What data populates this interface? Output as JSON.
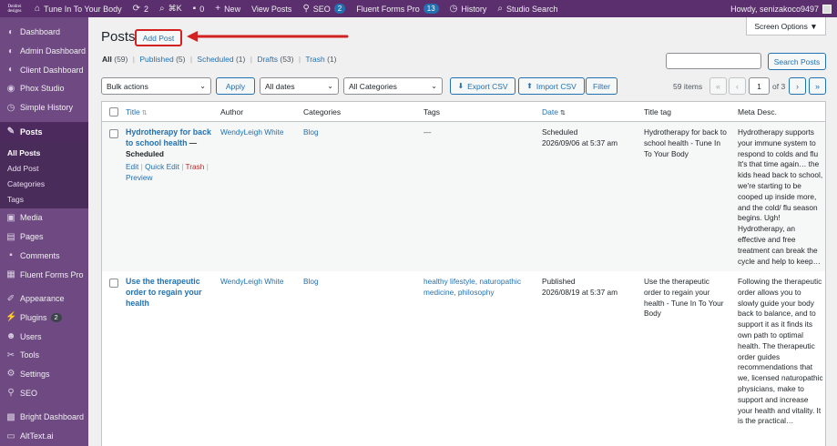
{
  "adminbar": {
    "logo_line1": "Deidrei",
    "logo_line2": "designs",
    "site_name": "Tune In To Your Body",
    "updates_count": "2",
    "shortcut": "⌘K",
    "comments_count": "0",
    "new_label": "New",
    "view_posts": "View Posts",
    "seo_label": "SEO",
    "seo_count": "2",
    "fluent_label": "Fluent Forms Pro",
    "fluent_count": "13",
    "history_label": "History",
    "studio_search": "Studio Search",
    "howdy": "Howdy, senizakoco9497"
  },
  "sidebar": {
    "items": [
      {
        "label": "Dashboard",
        "icon": "dashboard-icon"
      },
      {
        "label": "Admin Dashboard",
        "icon": "admin-dashboard-icon"
      },
      {
        "label": "Client Dashboard",
        "icon": "client-dashboard-icon"
      },
      {
        "label": "Phox Studio",
        "icon": "phox-icon"
      },
      {
        "label": "Simple History",
        "icon": "history-icon"
      },
      {
        "label": "Posts",
        "icon": "posts-icon"
      },
      {
        "label": "Media",
        "icon": "media-icon"
      },
      {
        "label": "Pages",
        "icon": "pages-icon"
      },
      {
        "label": "Comments",
        "icon": "comments-icon"
      },
      {
        "label": "Fluent Forms Pro",
        "icon": "forms-icon"
      },
      {
        "label": "Appearance",
        "icon": "appearance-icon"
      },
      {
        "label": "Plugins",
        "icon": "plugins-icon",
        "badge": "2"
      },
      {
        "label": "Users",
        "icon": "users-icon"
      },
      {
        "label": "Tools",
        "icon": "tools-icon"
      },
      {
        "label": "Settings",
        "icon": "settings-icon"
      },
      {
        "label": "SEO",
        "icon": "seo-icon"
      },
      {
        "label": "Bright Dashboard",
        "icon": "bright-icon"
      },
      {
        "label": "AltText.ai",
        "icon": "alttext-icon"
      }
    ],
    "posts_submenu": [
      "All Posts",
      "Add Post",
      "Categories",
      "Tags"
    ]
  },
  "main": {
    "screen_options": "Screen Options ▼",
    "page_title": "Posts",
    "add_post": "Add Post",
    "filters": {
      "all": "All",
      "all_count": "(59)",
      "published": "Published",
      "published_count": "(5)",
      "scheduled": "Scheduled",
      "scheduled_count": "(1)",
      "drafts": "Drafts",
      "drafts_count": "(53)",
      "trash": "Trash",
      "trash_count": "(1)",
      "separator": "|"
    },
    "search_button": "Search Posts",
    "bulk_actions": "Bulk actions",
    "apply": "Apply",
    "all_dates": "All dates",
    "all_categories": "All Categories",
    "export_csv": "Export CSV",
    "import_csv": "Import CSV",
    "filter": "Filter",
    "items_count": "59 items",
    "page_current": "1",
    "page_of": "of 3",
    "pager": {
      "first": "«",
      "prev": "‹",
      "next": "›",
      "last": "»"
    }
  },
  "table": {
    "columns": [
      "Title",
      "Author",
      "Categories",
      "Tags",
      "Date",
      "Title tag",
      "Meta Desc."
    ],
    "rows": [
      {
        "title": "Hydrotherapy for back to school health",
        "state": "— Scheduled",
        "actions": {
          "edit": "Edit",
          "quick_edit": "Quick Edit",
          "trash": "Trash",
          "preview": "Preview",
          "separator": "|"
        },
        "author": "WendyLeigh White",
        "category": "Blog",
        "tags": "—",
        "date_status": "Scheduled",
        "date": "2026/09/06 at 5:37 am",
        "title_tag": "Hydrotherapy for back to school health - Tune In To Your Body",
        "meta": "Hydrotherapy supports your immune system to respond to colds and flu It's that time again… the kids head back to school, we're starting to be cooped up inside more, and the cold/ flu season begins. Ugh! Hydrotherapy, an effective and free treatment can break the cycle and help to keep…"
      },
      {
        "title": "Use the therapeutic order to regain your health",
        "author": "WendyLeigh White",
        "category": "Blog",
        "tags": "healthy lifestyle, naturopathic medicine, philosophy",
        "date_status": "Published",
        "date": "2026/08/19 at 5:37 am",
        "title_tag": "Use the therapeutic order to regain your health - Tune In To Your Body",
        "meta": "Following the therapeutic order allows you to slowly guide your body back to balance, and to support it as it finds its own path to optimal health. The therapeutic order guides recommendations that we, licensed naturopathic physicians, make to support and increase your health and vitality. It is the practical…"
      }
    ]
  }
}
